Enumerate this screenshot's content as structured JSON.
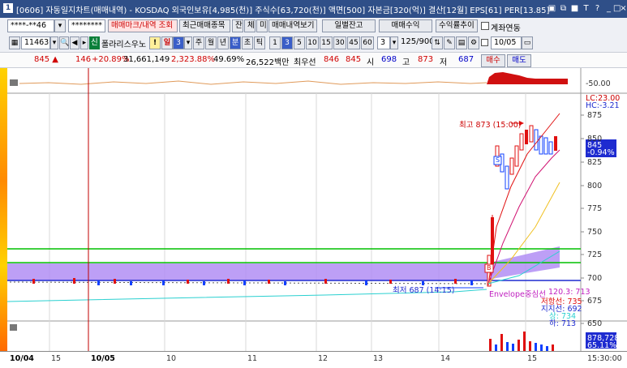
{
  "title_bar": {
    "icon": "1",
    "text": "[0606] 자동일지차트(매매내역) - KOSDAQ 외국인보유[4,985(천)] 주식수[63,720(천)] 액면[500] 자본금[320(억)] 결산[12월] EPS[61] PER[13.85]",
    "buttons": [
      "▣",
      "⧉",
      "■",
      "T",
      "?",
      "_",
      "□",
      "×"
    ]
  },
  "toolbar1": {
    "account": "****-**46",
    "password": "********",
    "btn_trade_mark": "매매마크/내역 조회",
    "btn_recent_items": "최근매매종목",
    "btn_balance": "잔",
    "btn_executed": "체",
    "btn_unfilled": "미",
    "btn_trade_history": "매매내역보기",
    "btn_daily_balance": "일별잔고",
    "btn_trade_profit": "매매수익",
    "btn_return_trend": "수익률추이",
    "chk_account_link": "계좌연동"
  },
  "toolbar2": {
    "code": "114630",
    "badge": "신",
    "stock_name": "폴라리스우노",
    "warn": "!",
    "period_day": "일",
    "period_num": "3",
    "periods": [
      "주",
      "월",
      "년",
      "분",
      "초",
      "틱"
    ],
    "intervals": [
      "1",
      "3",
      "5",
      "10",
      "15",
      "30",
      "45",
      "60"
    ],
    "interval_selected": "3",
    "count_display": "3",
    "view_count": "125/900",
    "date": "10/05"
  },
  "quote": {
    "price": "845 ▲",
    "change": "146",
    "change_rate": "+20.89%",
    "volume": "31,661,149",
    "volume_rate": "2,323.88%",
    "turnover": "49.69%",
    "amount": "26,522백만",
    "best_label": "최우선",
    "best_ask": "846",
    "best_bid": "845",
    "open_label": "시",
    "open": "698",
    "high_label": "고",
    "high": "873",
    "low_label": "저",
    "low": "687",
    "buy": "매수",
    "sell": "매도"
  },
  "indicator_panel": {
    "scale": "-50.00"
  },
  "price_panel": {
    "lc": "LC:23.00",
    "hc": "HC:-3.21",
    "y_ticks": [
      "875",
      "850",
      "825",
      "800",
      "775",
      "750",
      "725",
      "700",
      "675",
      "650"
    ],
    "current_price": "845",
    "current_rate": "-0.94%",
    "high_annot": "최고 873 (15:00)",
    "low_annot": "최저 687 (14:15)",
    "envelope_label": "Envelope중심선",
    "envelope_value": "120.3: 713",
    "upper_label": "저항선: 735",
    "support_label": "지지선: 692",
    "mid_label": "상: 734",
    "lower_label": "하: 713",
    "buy_marker": "B",
    "sell_marker": "S"
  },
  "volume_panel": {
    "value": "878,728",
    "rate": "65.11%"
  },
  "x_axis": {
    "labels": [
      "10/04",
      "15",
      "10/05",
      "10",
      "11",
      "12",
      "13",
      "14",
      "15",
      "15:30:00"
    ]
  },
  "colors": {
    "title_bg": "#2f4f88",
    "up": "#d00000",
    "down": "#0000c8",
    "envelope_fill": "#b28ef5",
    "support_line": "#00c000",
    "cursor_line": "#c00000"
  }
}
